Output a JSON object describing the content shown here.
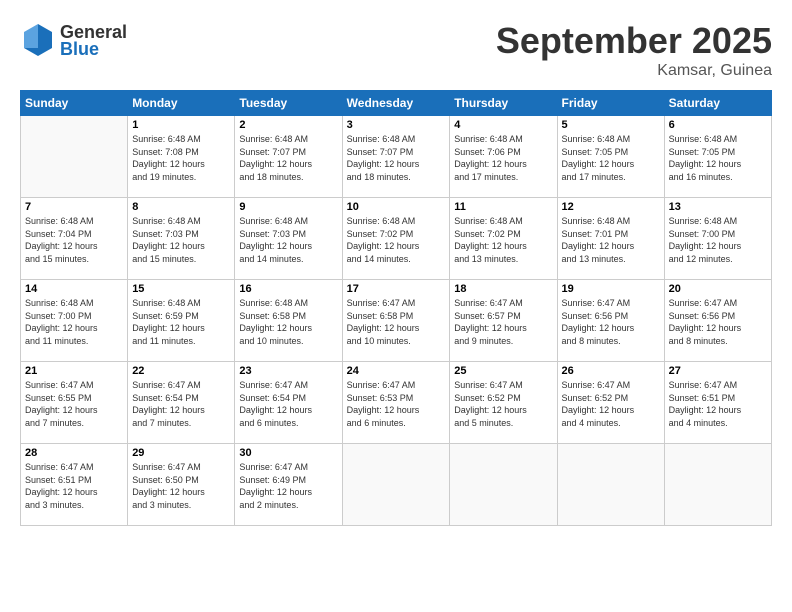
{
  "header": {
    "logo_line1": "General",
    "logo_line2": "Blue",
    "month": "September 2025",
    "location": "Kamsar, Guinea"
  },
  "weekdays": [
    "Sunday",
    "Monday",
    "Tuesday",
    "Wednesday",
    "Thursday",
    "Friday",
    "Saturday"
  ],
  "weeks": [
    [
      {
        "day": "",
        "info": ""
      },
      {
        "day": "1",
        "info": "Sunrise: 6:48 AM\nSunset: 7:08 PM\nDaylight: 12 hours\nand 19 minutes."
      },
      {
        "day": "2",
        "info": "Sunrise: 6:48 AM\nSunset: 7:07 PM\nDaylight: 12 hours\nand 18 minutes."
      },
      {
        "day": "3",
        "info": "Sunrise: 6:48 AM\nSunset: 7:07 PM\nDaylight: 12 hours\nand 18 minutes."
      },
      {
        "day": "4",
        "info": "Sunrise: 6:48 AM\nSunset: 7:06 PM\nDaylight: 12 hours\nand 17 minutes."
      },
      {
        "day": "5",
        "info": "Sunrise: 6:48 AM\nSunset: 7:05 PM\nDaylight: 12 hours\nand 17 minutes."
      },
      {
        "day": "6",
        "info": "Sunrise: 6:48 AM\nSunset: 7:05 PM\nDaylight: 12 hours\nand 16 minutes."
      }
    ],
    [
      {
        "day": "7",
        "info": "Sunrise: 6:48 AM\nSunset: 7:04 PM\nDaylight: 12 hours\nand 15 minutes."
      },
      {
        "day": "8",
        "info": "Sunrise: 6:48 AM\nSunset: 7:03 PM\nDaylight: 12 hours\nand 15 minutes."
      },
      {
        "day": "9",
        "info": "Sunrise: 6:48 AM\nSunset: 7:03 PM\nDaylight: 12 hours\nand 14 minutes."
      },
      {
        "day": "10",
        "info": "Sunrise: 6:48 AM\nSunset: 7:02 PM\nDaylight: 12 hours\nand 14 minutes."
      },
      {
        "day": "11",
        "info": "Sunrise: 6:48 AM\nSunset: 7:02 PM\nDaylight: 12 hours\nand 13 minutes."
      },
      {
        "day": "12",
        "info": "Sunrise: 6:48 AM\nSunset: 7:01 PM\nDaylight: 12 hours\nand 13 minutes."
      },
      {
        "day": "13",
        "info": "Sunrise: 6:48 AM\nSunset: 7:00 PM\nDaylight: 12 hours\nand 12 minutes."
      }
    ],
    [
      {
        "day": "14",
        "info": "Sunrise: 6:48 AM\nSunset: 7:00 PM\nDaylight: 12 hours\nand 11 minutes."
      },
      {
        "day": "15",
        "info": "Sunrise: 6:48 AM\nSunset: 6:59 PM\nDaylight: 12 hours\nand 11 minutes."
      },
      {
        "day": "16",
        "info": "Sunrise: 6:48 AM\nSunset: 6:58 PM\nDaylight: 12 hours\nand 10 minutes."
      },
      {
        "day": "17",
        "info": "Sunrise: 6:47 AM\nSunset: 6:58 PM\nDaylight: 12 hours\nand 10 minutes."
      },
      {
        "day": "18",
        "info": "Sunrise: 6:47 AM\nSunset: 6:57 PM\nDaylight: 12 hours\nand 9 minutes."
      },
      {
        "day": "19",
        "info": "Sunrise: 6:47 AM\nSunset: 6:56 PM\nDaylight: 12 hours\nand 8 minutes."
      },
      {
        "day": "20",
        "info": "Sunrise: 6:47 AM\nSunset: 6:56 PM\nDaylight: 12 hours\nand 8 minutes."
      }
    ],
    [
      {
        "day": "21",
        "info": "Sunrise: 6:47 AM\nSunset: 6:55 PM\nDaylight: 12 hours\nand 7 minutes."
      },
      {
        "day": "22",
        "info": "Sunrise: 6:47 AM\nSunset: 6:54 PM\nDaylight: 12 hours\nand 7 minutes."
      },
      {
        "day": "23",
        "info": "Sunrise: 6:47 AM\nSunset: 6:54 PM\nDaylight: 12 hours\nand 6 minutes."
      },
      {
        "day": "24",
        "info": "Sunrise: 6:47 AM\nSunset: 6:53 PM\nDaylight: 12 hours\nand 6 minutes."
      },
      {
        "day": "25",
        "info": "Sunrise: 6:47 AM\nSunset: 6:52 PM\nDaylight: 12 hours\nand 5 minutes."
      },
      {
        "day": "26",
        "info": "Sunrise: 6:47 AM\nSunset: 6:52 PM\nDaylight: 12 hours\nand 4 minutes."
      },
      {
        "day": "27",
        "info": "Sunrise: 6:47 AM\nSunset: 6:51 PM\nDaylight: 12 hours\nand 4 minutes."
      }
    ],
    [
      {
        "day": "28",
        "info": "Sunrise: 6:47 AM\nSunset: 6:51 PM\nDaylight: 12 hours\nand 3 minutes."
      },
      {
        "day": "29",
        "info": "Sunrise: 6:47 AM\nSunset: 6:50 PM\nDaylight: 12 hours\nand 3 minutes."
      },
      {
        "day": "30",
        "info": "Sunrise: 6:47 AM\nSunset: 6:49 PM\nDaylight: 12 hours\nand 2 minutes."
      },
      {
        "day": "",
        "info": ""
      },
      {
        "day": "",
        "info": ""
      },
      {
        "day": "",
        "info": ""
      },
      {
        "day": "",
        "info": ""
      }
    ]
  ]
}
